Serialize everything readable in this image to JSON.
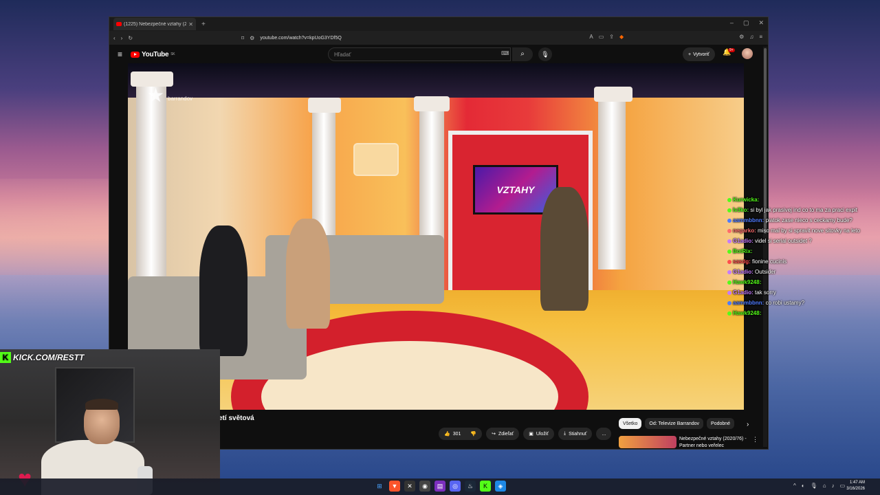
{
  "browser": {
    "tab_title": "(1225) Nebezpečné vztahy (2...",
    "url": "youtube.com/watch?v=kpUoG3YDf5Q"
  },
  "youtube": {
    "logo_text": "YouTube",
    "region": "SK",
    "search_placeholder": "Hľadať",
    "create_label": "Vytvoriť",
    "notif_count": "9+"
  },
  "video": {
    "channel_logo": "barrandov",
    "screen_text": "VZTAHY",
    "title_fragment": "etí světová"
  },
  "actions": {
    "likes": "301",
    "share": "Zdieľať",
    "save": "Uložiť",
    "download": "Stiahnuť",
    "more": "..."
  },
  "chips": [
    "Všetko",
    "Od: Televize Barrandov",
    "Podobné"
  ],
  "recommended": {
    "title": "Nebezpečné vztahy (2020/76) - Partner nebo veřelec"
  },
  "chat": [
    {
      "user": "Kurwicka:",
      "text": "",
      "color": "#53fc18"
    },
    {
      "user": "Iv3ko:",
      "text": "si byl jak prasivej ind co to ma za praci expit",
      "color": "#53fc18"
    },
    {
      "user": "aammbbnn:",
      "text": "piatok zase nieco s ceckamy bude?",
      "color": "#4f7bff"
    },
    {
      "user": "negarko:",
      "text": "miso mal by si spravit nove sitovky na leto",
      "color": "#ff6b6b"
    },
    {
      "user": "G1adio:",
      "text": "videl si serial outsidet ?",
      "color": "#c57bff"
    },
    {
      "user": "BotRix:",
      "text": "",
      "color": "#53fc18"
    },
    {
      "user": "sasdg:",
      "text": "fionine cucinis",
      "color": "#ff4d4d"
    },
    {
      "user": "G1adio:",
      "text": "Outsider",
      "color": "#c57bff"
    },
    {
      "user": "Hawk9248:",
      "text": "",
      "color": "#53fc18"
    },
    {
      "user": "G1adio:",
      "text": "tak sorry",
      "color": "#c57bff"
    },
    {
      "user": "aammbbnn:",
      "text": "co robi ustamy?",
      "color": "#4f7bff"
    },
    {
      "user": "Hawk9248:",
      "text": "",
      "color": "#53fc18"
    }
  ],
  "overlay": {
    "kick_text": "KICK.COM/RESTT"
  },
  "taskbar": {
    "time": "1:47 AM",
    "date": "3/16/2026"
  },
  "colors": {
    "youtube_red": "#ff0000",
    "kick_green": "#53fc18"
  }
}
